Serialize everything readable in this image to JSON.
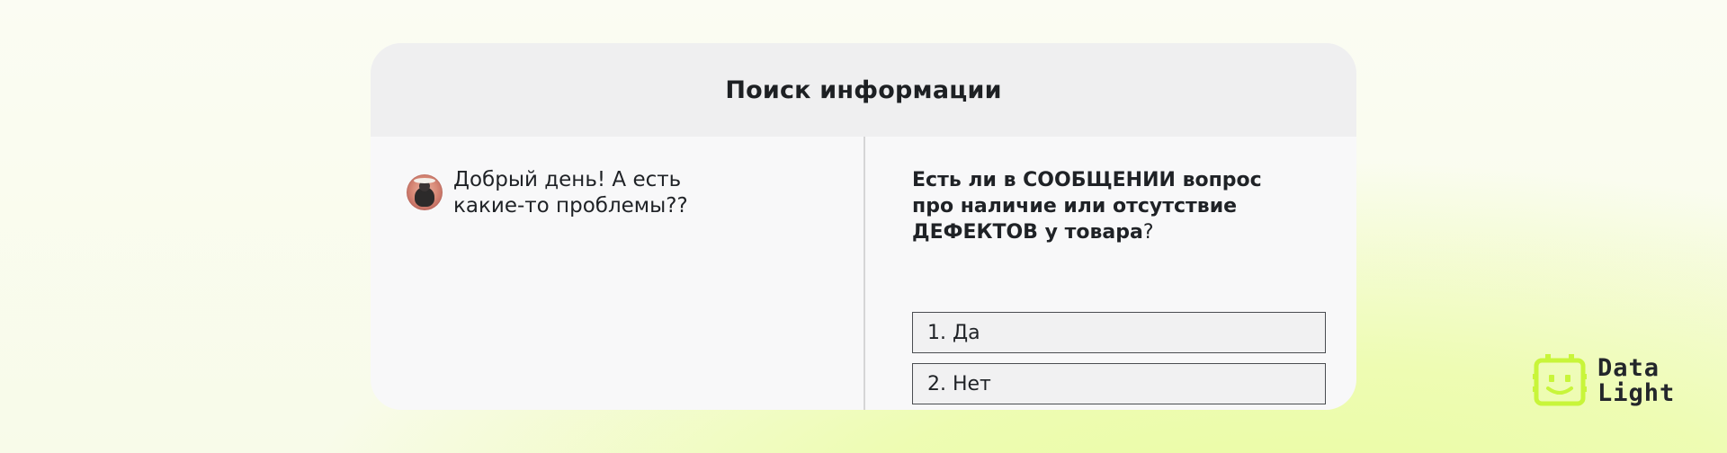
{
  "card": {
    "title": "Поиск информации"
  },
  "chat": {
    "message_line1": "Добрый день! А есть",
    "message_line2": "какие-то проблемы??"
  },
  "task": {
    "question_part1": "Есть ли в СООБЩЕНИИ вопрос",
    "question_part2": "про наличие или отсутствие",
    "question_part3": "ДЕФЕКТОВ у товара",
    "question_mark": "?",
    "options": [
      {
        "label": "1. Да"
      },
      {
        "label": "2. Нет"
      }
    ]
  },
  "logo": {
    "line1": "Data",
    "line2": "Light",
    "icon": "robot-face-icon",
    "color": "#c8f53a"
  },
  "colors": {
    "card_background": "#f8f8f9",
    "card_header": "#efeff0",
    "text": "#1f2226",
    "accent_glow": "#eafca0"
  }
}
